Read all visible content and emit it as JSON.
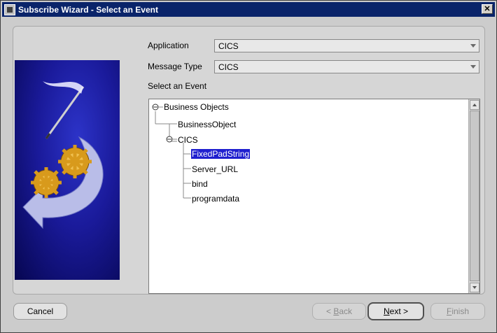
{
  "window": {
    "title": "Subscribe Wizard  - Select an Event",
    "close_glyph": "✕"
  },
  "form": {
    "application_label": "Application",
    "application_value": "CICS",
    "message_type_label": "Message Type",
    "message_type_value": "CICS",
    "select_event_label": "Select an Event"
  },
  "tree": {
    "root": "Business Objects",
    "children": [
      "BusinessObject",
      "CICS"
    ],
    "cics_children": [
      "FixedPadString",
      "Server_URL",
      "bind",
      "programdata"
    ],
    "selected": "FixedPadString"
  },
  "buttons": {
    "cancel": "Cancel",
    "back_prefix": "< ",
    "back_mnemonic": "B",
    "back_rest": "ack",
    "next_mnemonic": "N",
    "next_rest": "ext",
    "next_suffix": " >",
    "finish_mnemonic": "F",
    "finish_rest": "inish"
  },
  "colors": {
    "titlebar": "#0a246a",
    "selection": "#1f1fcf",
    "art_background": "#1a1a9a"
  }
}
